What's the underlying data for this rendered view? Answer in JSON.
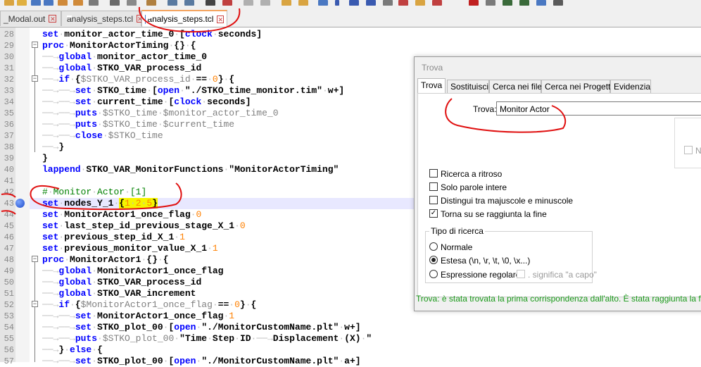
{
  "tabs": [
    {
      "label": "_Modal.out",
      "active": false
    },
    {
      "label": "analysis_steps.tcl",
      "active": false
    },
    {
      "label": "analysis_steps.tcl",
      "active": true
    }
  ],
  "editor": {
    "line_numbers": [
      "28",
      "29",
      "30",
      "31",
      "32",
      "33",
      "34",
      "35",
      "36",
      "37",
      "38",
      "39",
      "40",
      "41",
      "42",
      "43",
      "44",
      "45",
      "46",
      "47",
      "48",
      "49",
      "50",
      "51",
      "52",
      "53",
      "54",
      "55",
      "56",
      "57"
    ],
    "bookmark_line": "43"
  },
  "dialog": {
    "title": "Trova",
    "tabs": [
      "Trova",
      "Sostituisci",
      "Cerca nei file",
      "Cerca nei Progetti",
      "Evidenzia"
    ],
    "find_label": "Trova:",
    "find_value": "Monitor Actor",
    "ne_label": "Ne",
    "options": [
      {
        "label": "Ricerca a ritroso",
        "checked": false
      },
      {
        "label": "Solo parole intere",
        "checked": false
      },
      {
        "label": "Distingui tra majuscole e minuscole",
        "checked": false
      },
      {
        "label": "Torna su se raggiunta la fine",
        "checked": true
      }
    ],
    "search_type_title": "Tipo di ricerca",
    "search_types": [
      {
        "label": "Normale",
        "selected": false
      },
      {
        "label": "Estesa (\\n, \\r, \\t, \\0, \\x...)",
        "selected": true
      },
      {
        "label": "Espressione regolare",
        "selected": false
      }
    ],
    "regex_newline_label": ". significa \"a capo\"",
    "status": "Trova: è stata trovata la prima corrispondenza dall'alto. È stata raggiunta la fine"
  },
  "colors": {
    "status": "#1a9a1a",
    "keyword": "#0000ff",
    "number": "#ff8000",
    "comment": "#008000",
    "annotation": "#e01010"
  }
}
